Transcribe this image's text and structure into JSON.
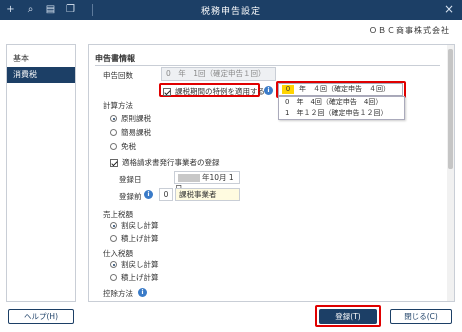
{
  "window": {
    "title": "税務申告設定",
    "close_icon": "×"
  },
  "toolbar": {
    "icons": [
      "add-icon",
      "search-icon",
      "print-icon",
      "copy-icon"
    ]
  },
  "company": "ＯＢＣ商事株式会社",
  "sidebar": {
    "items": [
      {
        "label": "基本"
      },
      {
        "label": "消費税"
      }
    ]
  },
  "main": {
    "section_title": "申告書情報",
    "filing_count": {
      "label": "申告回数",
      "value": "0　年　1回（確定申告１回）"
    },
    "special_period": {
      "label": "課税期間の特例を適用する",
      "checked": true
    },
    "combo": {
      "num": "0",
      "text": "年　４回（確定申告　４回）"
    },
    "dropdown": [
      "0　年　4回（確定申告　4回）",
      "1　年１２回（確定申告１２回）"
    ],
    "method": {
      "label": "計算方法",
      "options": [
        "原則課税",
        "簡易課税",
        "免税"
      ],
      "selected": 0
    },
    "invoice": {
      "label": "適格請求書発行事業者の登録",
      "checked": true
    },
    "reg_date": {
      "label": "登録日",
      "value": "年10月  1日"
    },
    "reg_before": {
      "label": "登録前",
      "code": "0",
      "name": "課税事業者"
    },
    "sales": {
      "label": "売上税額",
      "options": [
        "割戻し計算",
        "積上げ計算"
      ],
      "selected": 0
    },
    "purchase": {
      "label": "仕入税額",
      "options": [
        "割戻し計算",
        "積上げ計算"
      ],
      "selected": 0
    },
    "deduction": {
      "label": "控除方法"
    }
  },
  "footer": {
    "help": "ヘルプ(H)",
    "register": "登録(T)",
    "close": "閉じる(C)"
  },
  "colors": {
    "accent": "#1c3f66",
    "highlight": "#e00000",
    "yellow": "#ffd400"
  }
}
